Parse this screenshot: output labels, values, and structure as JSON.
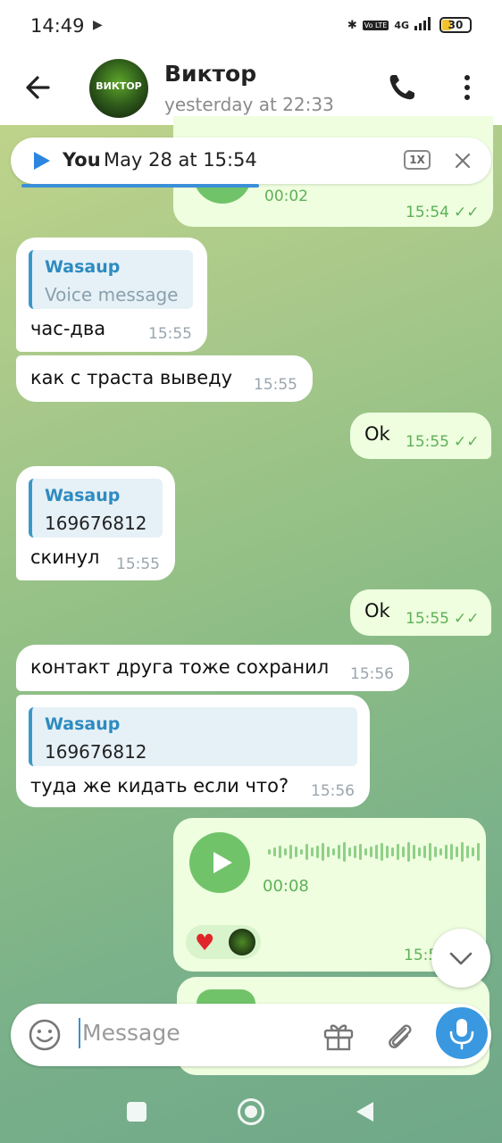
{
  "status": {
    "time": "14:49",
    "network_label": "4G",
    "volte_label": "Vo LTE",
    "battery": "30"
  },
  "chat": {
    "name": "Виктор",
    "last_seen": "yesterday at 22:33",
    "avatar_text": "ВИКТОР"
  },
  "pinned": {
    "sender": "You",
    "date": "May 28 at 15:54",
    "speed": "1X"
  },
  "messages": [
    {
      "type": "voice",
      "dir": "out",
      "duration": "00:02",
      "time": "15:54"
    },
    {
      "type": "reply",
      "dir": "in",
      "reply_name": "Wasaup",
      "reply_text": "Voice message",
      "text": "час-два",
      "time": "15:55"
    },
    {
      "type": "text",
      "dir": "in",
      "text": "как с траста выведу",
      "time": "15:55"
    },
    {
      "type": "text",
      "dir": "out",
      "text": "Ok",
      "time": "15:55"
    },
    {
      "type": "reply",
      "dir": "in",
      "reply_name": "Wasaup",
      "reply_text": "169676812",
      "text": "скинул",
      "time": "15:55"
    },
    {
      "type": "text",
      "dir": "out",
      "text": "Ok",
      "time": "15:55"
    },
    {
      "type": "text",
      "dir": "in",
      "text": "контакт друга тоже сохранил",
      "time": "15:56"
    },
    {
      "type": "reply",
      "dir": "in",
      "reply_name": "Wasaup",
      "reply_text": "169676812",
      "text": "туда же кидать если что?",
      "time": "15:56"
    },
    {
      "type": "voice",
      "dir": "out",
      "duration": "00:08",
      "time": "15:5",
      "reactions": [
        "heart"
      ]
    }
  ],
  "input": {
    "placeholder": "Message"
  },
  "colors": {
    "accent": "#3a98e0",
    "out_bubble": "#eefedf",
    "in_bubble": "#ffffff",
    "check": "#5fb058"
  }
}
